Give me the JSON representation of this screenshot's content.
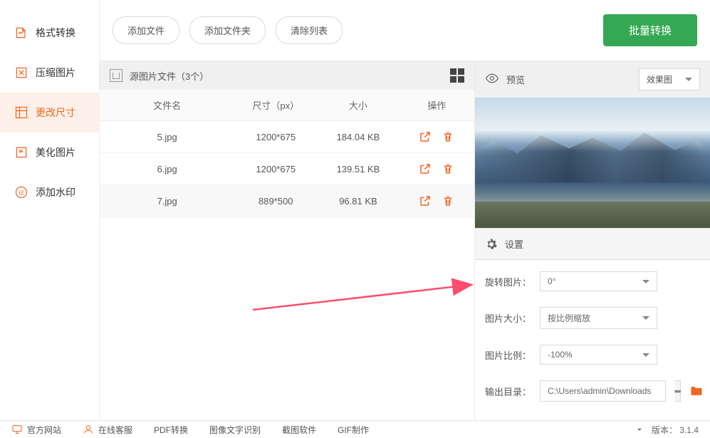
{
  "sidebar": {
    "items": [
      {
        "label": "格式转换",
        "name": "sidebar-item-format"
      },
      {
        "label": "压缩图片",
        "name": "sidebar-item-compress"
      },
      {
        "label": "更改尺寸",
        "name": "sidebar-item-resize"
      },
      {
        "label": "美化图片",
        "name": "sidebar-item-beautify"
      },
      {
        "label": "添加水印",
        "name": "sidebar-item-watermark"
      }
    ]
  },
  "toolbar": {
    "add_file": "添加文件",
    "add_folder": "添加文件夹",
    "clear_list": "清除列表",
    "batch_convert": "批量转换"
  },
  "filelist": {
    "header": "源图片文件（3个）",
    "columns": {
      "name": "文件名",
      "dim": "尺寸（px）",
      "size": "大小",
      "action": "操作"
    },
    "rows": [
      {
        "name": "5.jpg",
        "dim": "1200*675",
        "size": "184.04 KB"
      },
      {
        "name": "6.jpg",
        "dim": "1200*675",
        "size": "139.51 KB"
      },
      {
        "name": "7.jpg",
        "dim": "889*500",
        "size": "96.81 KB"
      }
    ]
  },
  "preview": {
    "title": "预览",
    "dropdown": "效果图"
  },
  "settings": {
    "title": "设置",
    "rotate_label": "旋转图片：",
    "rotate_value": "0°",
    "size_label": "图片大小：",
    "size_value": "按比例缩放",
    "ratio_label": "图片比例：",
    "ratio_value": "-100%",
    "output_label": "输出目录：",
    "output_value": "C:\\Users\\admin\\Downloads"
  },
  "footer": {
    "website": "官方网站",
    "service": "在线客服",
    "pdf": "PDF转换",
    "ocr": "图像文字识别",
    "screenshot": "截图软件",
    "gif": "GIF制作",
    "version_label": "版本：",
    "version_value": "3.1.4"
  }
}
